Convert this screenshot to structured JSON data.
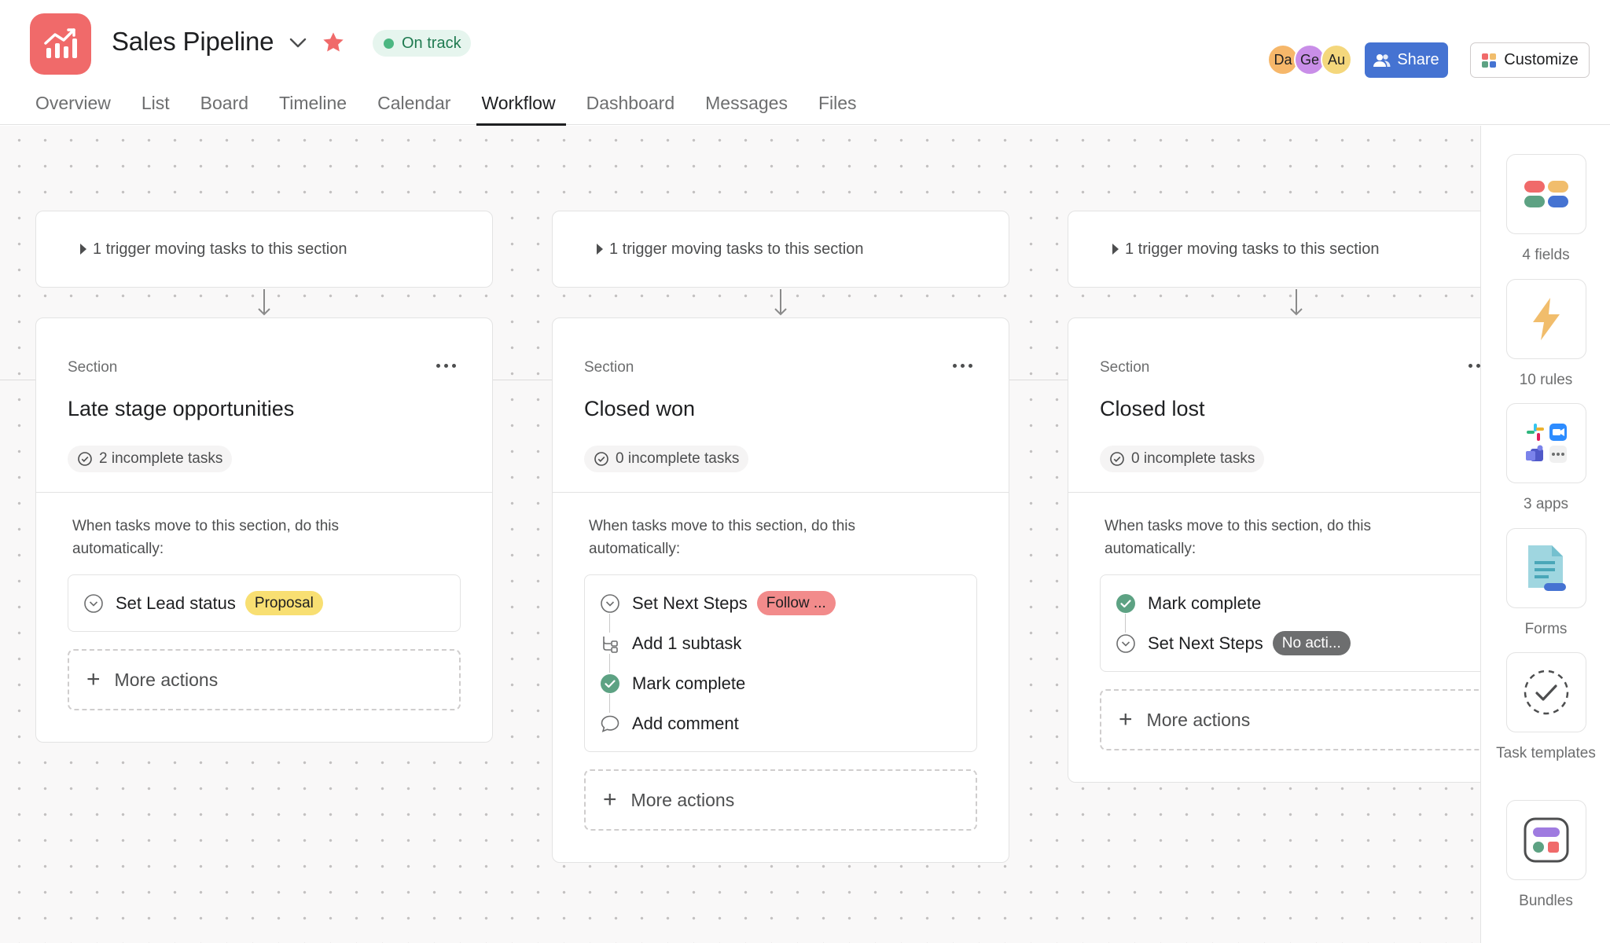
{
  "project": {
    "title": "Sales Pipeline",
    "status": "On track",
    "brand_color": "#f06a6a",
    "status_color": "#4cb782"
  },
  "header": {
    "avatars": [
      {
        "initials": "Da",
        "color": "#f6b76a"
      },
      {
        "initials": "Ge",
        "color": "#c98ee8"
      },
      {
        "initials": "Au",
        "color": "#f4d77c"
      }
    ],
    "share_label": "Share",
    "customize_label": "Customize"
  },
  "tabs": [
    {
      "label": "Overview"
    },
    {
      "label": "List"
    },
    {
      "label": "Board"
    },
    {
      "label": "Timeline"
    },
    {
      "label": "Calendar"
    },
    {
      "label": "Workflow",
      "active": true
    },
    {
      "label": "Dashboard"
    },
    {
      "label": "Messages"
    },
    {
      "label": "Files"
    }
  ],
  "columns": [
    {
      "trigger": "1 trigger moving tasks to this section",
      "section_label": "Section",
      "name": "Late stage opportunities",
      "incomplete": "2 incomplete tasks",
      "auto_text": "When tasks move to this section, do this automatically:",
      "actions": [
        {
          "icon": "dropdown-field-icon",
          "label": "Set Lead status",
          "chip": "Proposal",
          "chip_color": "#f8df72",
          "chip_text_color": "#1e1f21"
        }
      ],
      "more_actions": "More actions"
    },
    {
      "trigger": "1 trigger moving tasks to this section",
      "section_label": "Section",
      "name": "Closed won",
      "incomplete": "0 incomplete tasks",
      "auto_text": "When tasks move to this section, do this automatically:",
      "actions": [
        {
          "icon": "dropdown-field-icon",
          "label": "Set Next Steps",
          "chip": "Follow ...",
          "chip_color": "#f28b8b",
          "chip_text_color": "#1e1f21"
        },
        {
          "icon": "subtask-icon",
          "label": "Add 1 subtask"
        },
        {
          "icon": "check-complete-icon",
          "label": "Mark complete"
        },
        {
          "icon": "comment-icon",
          "label": "Add comment"
        }
      ],
      "more_actions": "More actions"
    },
    {
      "trigger": "1 trigger moving tasks to this section",
      "section_label": "Section",
      "name": "Closed lost",
      "incomplete": "0 incomplete tasks",
      "auto_text": "When tasks move to this section, do this automatically:",
      "actions": [
        {
          "icon": "check-complete-icon",
          "label": "Mark complete"
        },
        {
          "icon": "dropdown-field-icon",
          "label": "Set Next Steps",
          "chip": "No acti...",
          "chip_color": "#6d6e6f",
          "chip_text_color": "#ffffff"
        }
      ],
      "more_actions": "More actions"
    }
  ],
  "rail": [
    {
      "icon": "fields-icon",
      "label": "4 fields"
    },
    {
      "icon": "lightning-icon",
      "label": "10 rules"
    },
    {
      "icon": "apps-icon",
      "label": "3 apps"
    },
    {
      "icon": "form-icon",
      "label": "Forms"
    },
    {
      "icon": "task-template-icon",
      "label": "Task templates"
    },
    {
      "icon": "bundle-icon",
      "label": "Bundles"
    }
  ]
}
